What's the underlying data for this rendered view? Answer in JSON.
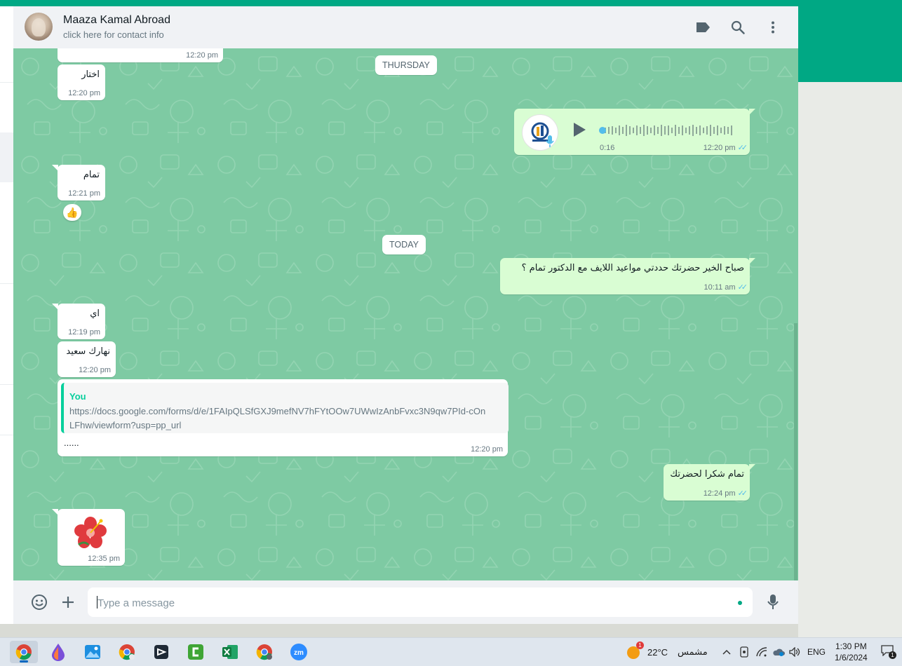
{
  "header": {
    "contact_name": "Maaza Kamal Abroad",
    "contact_sub": "click here for contact info"
  },
  "chat": {
    "day_thursday": "THURSDAY",
    "day_today": "TODAY",
    "messages": [
      {
        "dir": "in",
        "text": "",
        "time": "12:20 pm"
      },
      {
        "dir": "in",
        "text": "اختار",
        "time": "12:20 pm"
      },
      {
        "dir": "out",
        "type": "voice",
        "duration": "0:16",
        "time": "12:20 pm"
      },
      {
        "dir": "in",
        "text": "تمام",
        "time": "12:21 pm",
        "reaction": "👍"
      },
      {
        "dir": "out",
        "text": "صباح الخير حضرتك حددتي مواعيد اللايف مع الدكتور تمام ؟",
        "time": "10:11 am"
      },
      {
        "dir": "in",
        "text": "اي",
        "time": "12:19 pm"
      },
      {
        "dir": "in",
        "text": "نهارك سعيد",
        "time": "12:20 pm"
      },
      {
        "dir": "in",
        "type": "quote",
        "quote_author": "You",
        "quote_text": "https://docs.google.com/forms/d/e/1FAIpQLSfGXJ9mefNV7hFYtOOw7UWwIzAnbFvxc3N9qw7PId-cOnLFhw/viewform?usp=pp_url",
        "text": "......",
        "time": "12:20 pm"
      },
      {
        "dir": "out",
        "text": "تمام شكرا لحضرتك",
        "time": "12:24 pm"
      },
      {
        "dir": "in",
        "type": "sticker",
        "sticker": "hibiscus-flower",
        "time": "12:35 pm"
      }
    ]
  },
  "composer": {
    "placeholder": "Type a message"
  },
  "taskbar": {
    "apps": [
      "chrome",
      "paint",
      "photos",
      "chrome",
      "capcut",
      "camtasia",
      "excel",
      "chrome",
      "zoom"
    ],
    "weather_badge": "1",
    "temperature": "22°C",
    "weather_text": "مشمس",
    "language": "ENG",
    "time": "1:30 PM",
    "date": "1/6/2024",
    "notification_count": "1"
  },
  "colors": {
    "accent": "#00a884",
    "chat_bg": "#7ecaa3",
    "outgoing_bubble": "#d9fdd3",
    "read_tick": "#53bdeb"
  }
}
